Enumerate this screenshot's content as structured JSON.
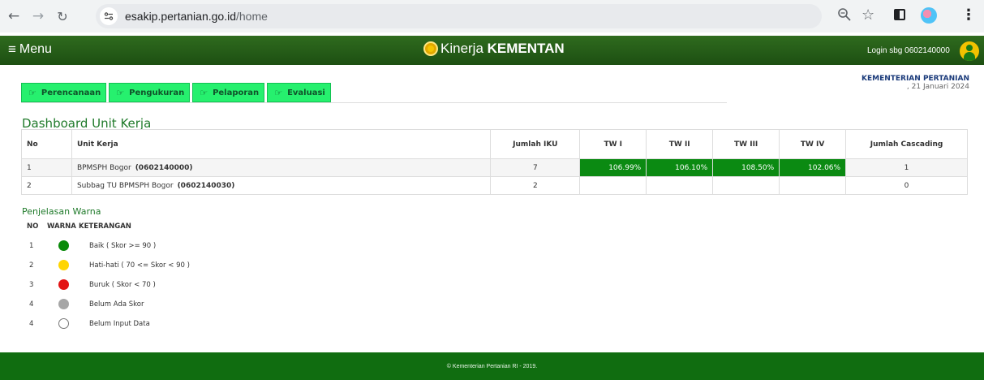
{
  "browser": {
    "url_host": "esakip.pertanian.go.id",
    "url_path": "/home",
    "icons": [
      "back-arrow",
      "forward-arrow",
      "reload",
      "site-info",
      "zoom",
      "bookmark-star",
      "side-panel",
      "profile",
      "menu-kebab"
    ]
  },
  "header": {
    "menu_label": "Menu",
    "brand_light": "Kinerja ",
    "brand_bold": "KEMENTAN",
    "login_text": "Login sbg 0602140000",
    "colors": {
      "bar": "#2f6b1e",
      "logo": "#f5c400"
    }
  },
  "tabs": [
    {
      "label": "Perencanaan"
    },
    {
      "label": "Pengukuran"
    },
    {
      "label": "Pelaporan"
    },
    {
      "label": "Evaluasi"
    }
  ],
  "ministry": {
    "name": "KEMENTERIAN PERTANIAN",
    "date": ", 21 Januari 2024"
  },
  "dashboard": {
    "title": "Dashboard Unit Kerja",
    "columns": {
      "no": "No",
      "unit": "Unit Kerja",
      "iku": "Jumlah IKU",
      "tw1": "TW I",
      "tw2": "TW II",
      "tw3": "TW III",
      "tw4": "TW IV",
      "cascading": "Jumlah Cascading"
    },
    "rows": [
      {
        "no": "1",
        "unit": "BPMSPH Bogor",
        "code": "(0602140000)",
        "iku": "7",
        "tw1": "106.99%",
        "tw2": "106.10%",
        "tw3": "108.50%",
        "tw4": "102.06%",
        "cascading": "1"
      },
      {
        "no": "2",
        "unit": "Subbag TU BPMSPH Bogor",
        "code": "(0602140030)",
        "iku": "2",
        "tw1": "",
        "tw2": "",
        "tw3": "",
        "tw4": "",
        "cascading": "0"
      }
    ],
    "score_color": "#0b8a12"
  },
  "legend": {
    "title": "Penjelasan Warna",
    "headers": {
      "no": "NO",
      "warna": "WARNA",
      "keterangan": "KETERANGAN"
    },
    "items": [
      {
        "no": "1",
        "color": "#0a8a0a",
        "desc": "Baik ( Skor >= 90 )"
      },
      {
        "no": "2",
        "color": "#ffd500",
        "desc": "Hati-hati ( 70 <= Skor < 90 )"
      },
      {
        "no": "3",
        "color": "#e31414",
        "desc": "Buruk ( Skor < 70 )"
      },
      {
        "no": "4",
        "color": "#a6a6a6",
        "desc": "Belum Ada Skor"
      },
      {
        "no": "4",
        "color": "#ffffff",
        "desc": "Belum Input Data"
      }
    ]
  },
  "footer": {
    "text": "© Kementerian Pertanian RI - 2019."
  }
}
